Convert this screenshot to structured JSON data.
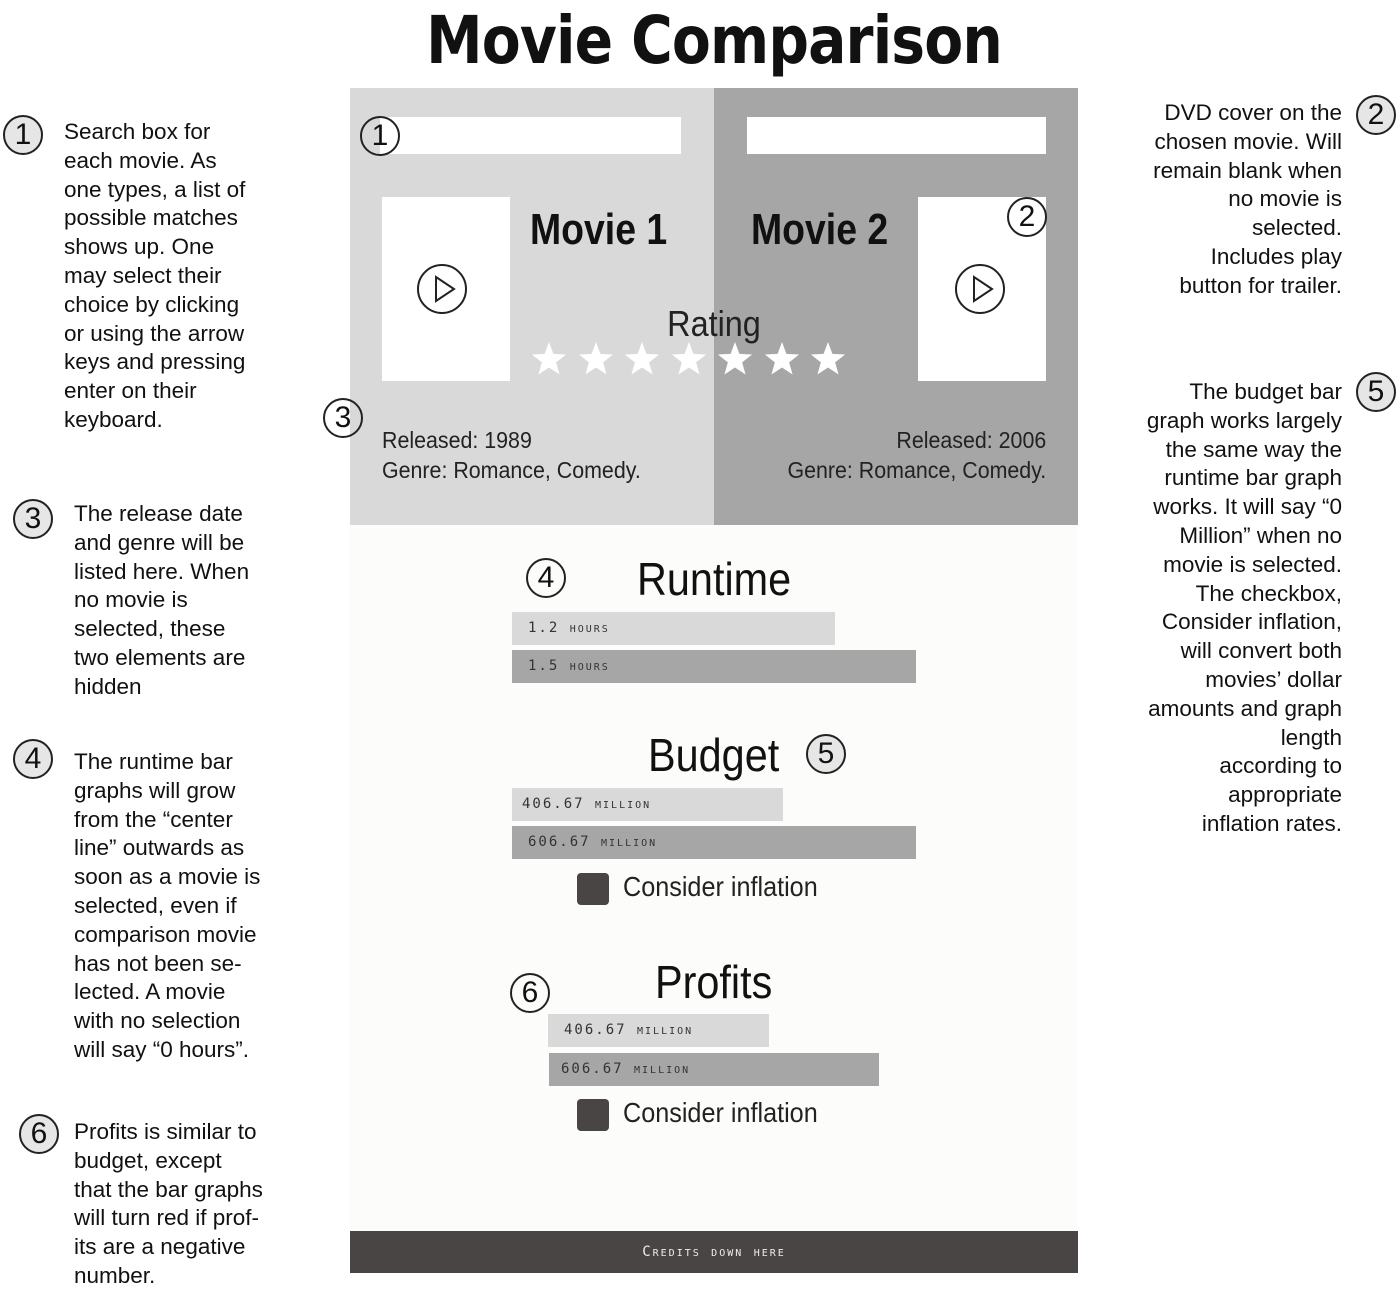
{
  "page_title": "Movie Comparison",
  "annotations": {
    "note1": "Search box for\neach movie. As\none types, a list of\npossible matches\nshows up. One\nmay select their\nchoice by clicking\nor using the arrow\nkeys and pressing\nenter on their\nkeyboard.",
    "note2": "DVD cover on the\nchosen movie. Will\nremain blank when\nno movie is\nselected.\nIncludes play\nbutton for trailer.",
    "note3": "The release date\nand genre will be\nlisted here. When\nno movie is\nselected, these\ntwo elements are\nhidden",
    "note4": "The runtime bar\ngraphs will grow\nfrom the “center\nline” outwards as\nsoon as a movie is\nselected, even if\ncomparison movie\nhas not been se-\nlected. A movie\nwith no selection\nwill say “0 hours”.",
    "note5": "The budget bar\ngraph works largely\nthe same way the\nruntime bar graph\nworks. It will say “0\nMillion” when no\nmovie is selected.\nThe checkbox,\nConsider inflation,\nwill convert both\nmovies’ dollar\namounts and graph\nlength\naccording to\nappropriate\ninflation rates.",
    "note6": "Profits is similar to\nbudget, except\nthat the bar graphs\nwill turn red if prof-\nits are a negative\nnumber."
  },
  "markers": [
    "1",
    "2",
    "3",
    "4",
    "5",
    "6"
  ],
  "movies": [
    {
      "title": "Movie 1",
      "released": "Released: 1989",
      "genre": "Genre: Romance, Comedy."
    },
    {
      "title": "Movie 2",
      "released": "Released: 2006",
      "genre": "Genre: Romance, Comedy."
    }
  ],
  "rating": {
    "label": "Rating",
    "stars": 7
  },
  "runtime": {
    "title": "Runtime",
    "bars": [
      {
        "label": "1.2 hours",
        "value": 1.2
      },
      {
        "label": "1.5 hours",
        "value": 1.5
      }
    ]
  },
  "budget": {
    "title": "Budget",
    "bars": [
      {
        "label": "406.67 million",
        "value": 406.67
      },
      {
        "label": "606.67 million",
        "value": 606.67
      }
    ],
    "checkbox_label": "Consider inflation"
  },
  "profits": {
    "title": "Profits",
    "bars": [
      {
        "label": "406.67 million",
        "value": 406.67
      },
      {
        "label": "606.67 million",
        "value": 606.67
      }
    ],
    "checkbox_label": "Consider inflation"
  },
  "credits": "Credits down here",
  "colors": {
    "panel_left": "#d9d9d9",
    "panel_right": "#a6a6a6",
    "bar_light": "#d9d9d9",
    "bar_dark": "#a6a6a6",
    "dark": "#4a4545"
  },
  "icons": {
    "play": "play-icon",
    "star": "star-icon"
  }
}
